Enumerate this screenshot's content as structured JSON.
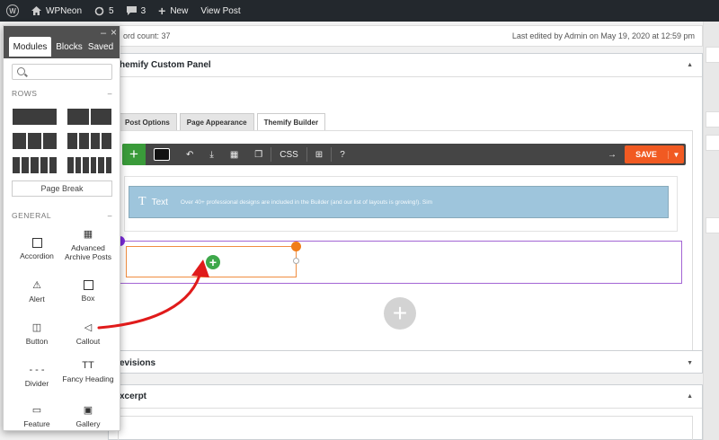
{
  "adminbar": {
    "site_name": "WPNeon",
    "updates_count": "5",
    "comments_count": "3",
    "new_label": "New",
    "view_post_label": "View Post"
  },
  "status": {
    "word_count": "ord count: 37",
    "last_edited": "Last edited by Admin on May 19, 2020 at 12:59 pm"
  },
  "custom_panel": {
    "title": "hemify Custom Panel",
    "tabs": [
      "Post Options",
      "Page Appearance",
      "Themify Builder"
    ],
    "active_tab_index": 2
  },
  "builder_toolbar": {
    "css_label": "CSS",
    "help_label": "?",
    "save_label": "SAVE",
    "accent_color": "#f15a22"
  },
  "text_module": {
    "label": "Text",
    "preview": "Over 40+ professional designs are included in the Builder (and our list of layouts is growing!). Sim"
  },
  "revisions": {
    "title": "evisions"
  },
  "excerpt": {
    "title": "xcerpt"
  },
  "modules_panel": {
    "tabs": [
      "Modules",
      "Blocks",
      "Saved"
    ],
    "active_tab_index": 0,
    "search_placeholder": "",
    "rows_heading": "ROWS",
    "page_break_label": "Page Break",
    "general_heading": "GENERAL",
    "collapse_symbol": "–",
    "minimize_symbol": "–",
    "close_symbol": "×",
    "modules": [
      {
        "label": "Accordion",
        "icon": "accordion-icon"
      },
      {
        "label": "Advanced Archive Posts",
        "icon": "archive-grid-icon"
      },
      {
        "label": "Alert",
        "icon": "alert-icon"
      },
      {
        "label": "Box",
        "icon": "box-icon"
      },
      {
        "label": "Button",
        "icon": "mouse-icon"
      },
      {
        "label": "Callout",
        "icon": "megaphone-icon"
      },
      {
        "label": "Divider",
        "icon": "divider-icon"
      },
      {
        "label": "Fancy Heading",
        "icon": "fancy-heading-icon"
      },
      {
        "label": "Feature",
        "icon": "feature-icon"
      },
      {
        "label": "Gallery",
        "icon": "gallery-icon"
      }
    ]
  }
}
